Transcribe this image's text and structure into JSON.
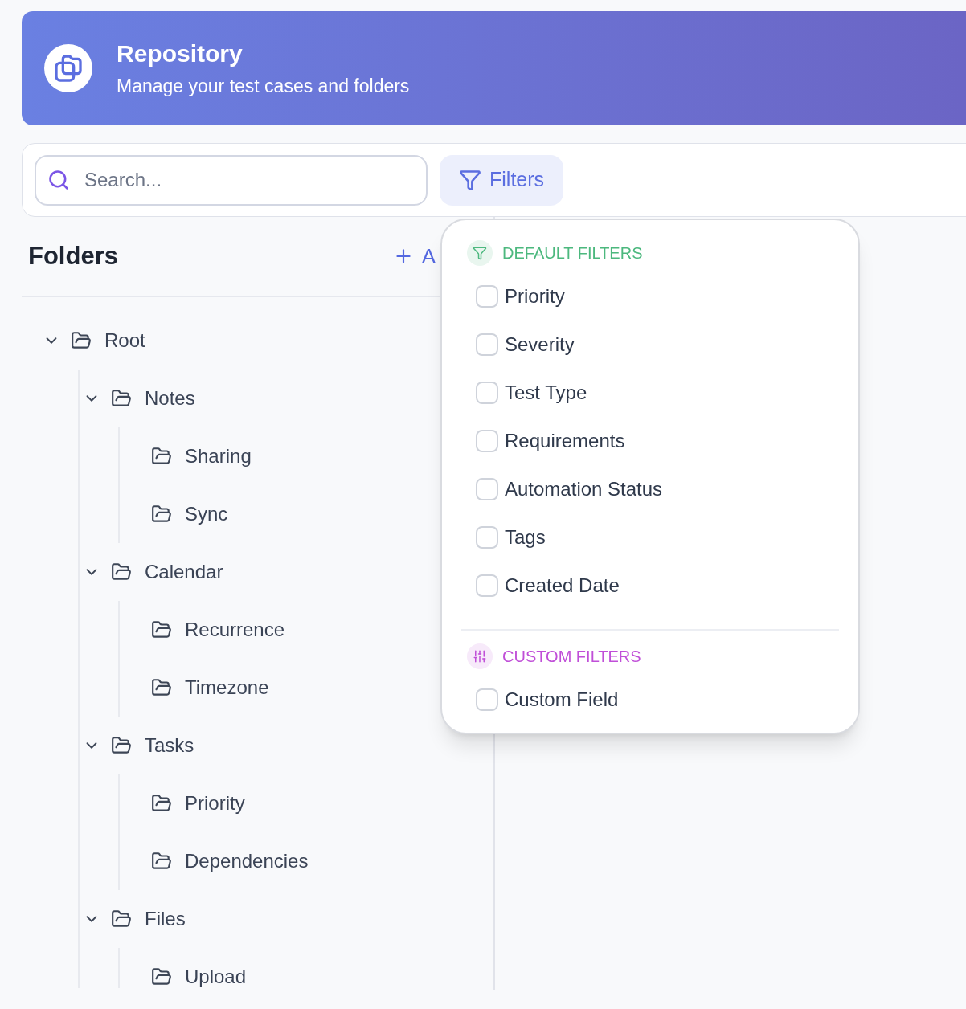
{
  "header": {
    "title": "Repository",
    "subtitle": "Manage your test cases and folders"
  },
  "toolbar": {
    "search": {
      "placeholder": "Search..."
    },
    "filters_button": {
      "label": "Filters",
      "selected": true
    }
  },
  "folders_panel": {
    "title": "Folders",
    "add_button": "A",
    "tree": [
      {
        "name": "Root",
        "expanded": true,
        "children": [
          {
            "name": "Notes",
            "expanded": true,
            "children": [
              {
                "name": "Sharing"
              },
              {
                "name": "Sync"
              }
            ]
          },
          {
            "name": "Calendar",
            "expanded": true,
            "children": [
              {
                "name": "Recurrence"
              },
              {
                "name": "Timezone"
              }
            ]
          },
          {
            "name": "Tasks",
            "expanded": true,
            "children": [
              {
                "name": "Priority"
              },
              {
                "name": "Dependencies"
              }
            ]
          },
          {
            "name": "Files",
            "expanded": true,
            "children": [
              {
                "name": "Upload"
              }
            ]
          }
        ]
      }
    ]
  },
  "filters_menu": {
    "sections": [
      {
        "kind": "default",
        "title": "DEFAULT FILTERS",
        "color": "#4cb87e",
        "items": [
          {
            "label": "Priority",
            "checked": false
          },
          {
            "label": "Severity",
            "checked": false
          },
          {
            "label": "Test Type",
            "checked": false
          },
          {
            "label": "Requirements",
            "checked": false
          },
          {
            "label": "Automation Status",
            "checked": false
          },
          {
            "label": "Tags",
            "checked": false
          },
          {
            "label": "Created Date",
            "checked": false
          }
        ]
      },
      {
        "kind": "custom",
        "title": "CUSTOM FILTERS",
        "color": "#c04fd8",
        "items": [
          {
            "label": "Custom Field",
            "checked": false
          }
        ]
      }
    ]
  }
}
